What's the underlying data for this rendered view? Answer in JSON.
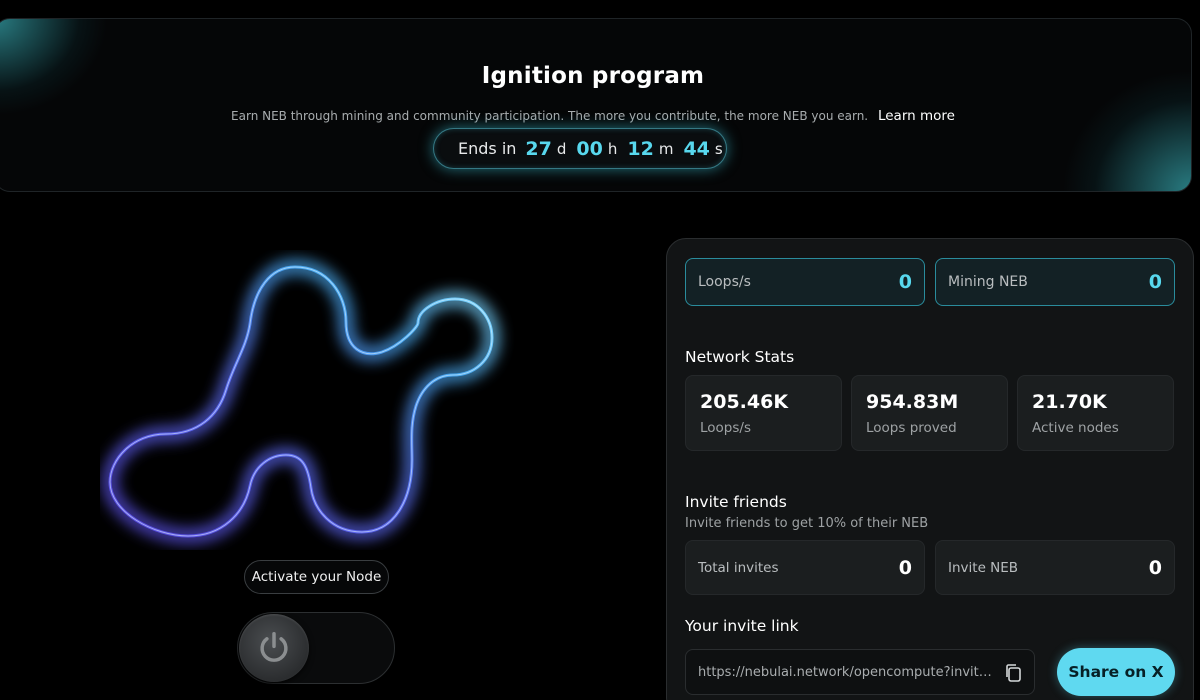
{
  "banner": {
    "title": "Ignition program",
    "description": "Earn NEB through mining and community participation. The more you contribute, the more NEB you earn.",
    "learn_more": "Learn more",
    "countdown": {
      "label": "Ends in",
      "days": "27",
      "days_unit": "d",
      "hours": "00",
      "hours_unit": "h",
      "minutes": "12",
      "minutes_unit": "m",
      "seconds": "44",
      "seconds_unit": "s"
    }
  },
  "node": {
    "activate_label": "Activate your Node",
    "toggle_state": "off"
  },
  "panel": {
    "loops_per_sec": {
      "label": "Loops/s",
      "value": "0"
    },
    "mining_neb": {
      "label": "Mining NEB",
      "value": "0"
    },
    "network_stats": {
      "title": "Network Stats",
      "cards": [
        {
          "value": "205.46K",
          "label": "Loops/s"
        },
        {
          "value": "954.83M",
          "label": "Loops proved"
        },
        {
          "value": "21.70K",
          "label": "Active nodes"
        }
      ]
    },
    "invite": {
      "title": "Invite friends",
      "subtitle": "Invite friends to get 10% of their NEB",
      "total_invites": {
        "label": "Total invites",
        "value": "0"
      },
      "invite_neb": {
        "label": "Invite NEB",
        "value": "0"
      }
    },
    "invite_link": {
      "title": "Your invite link",
      "value": "https://nebulai.network/opencompute?invite_...",
      "share_label": "Share on X"
    }
  },
  "colors": {
    "accent": "#58d8ee",
    "button": "#5fd9f0",
    "background": "#000000",
    "panel": "#121415"
  },
  "icons": {
    "countdown": "stopwatch-icon",
    "power": "power-icon",
    "copy": "copy-icon"
  }
}
